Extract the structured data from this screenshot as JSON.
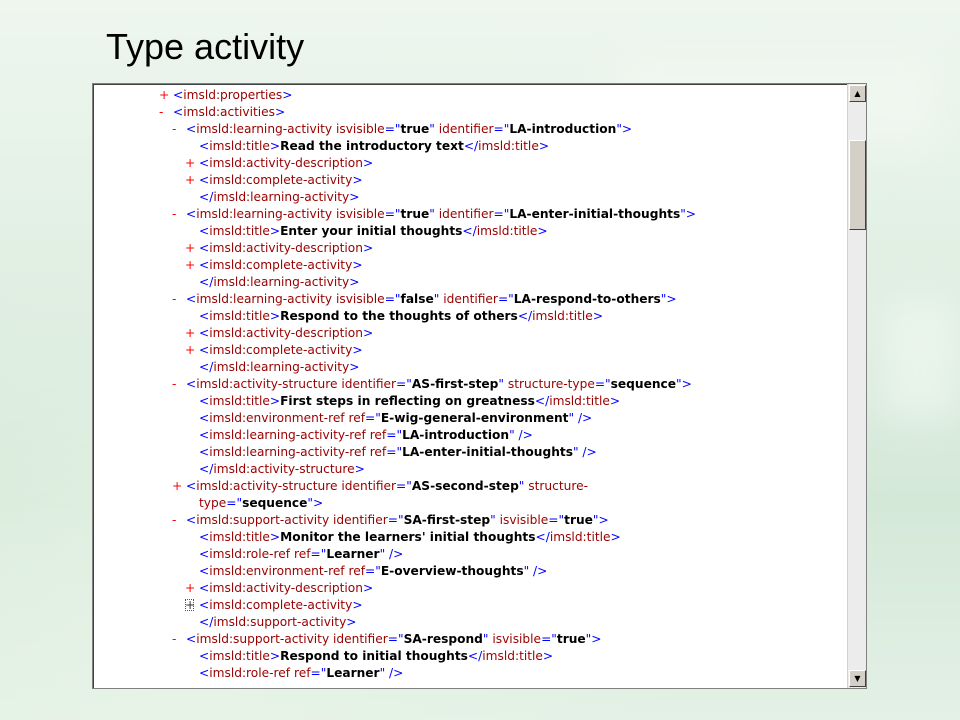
{
  "slide": {
    "title": "Type activity"
  },
  "xml_lines": [
    {
      "indent": 0,
      "toggle": "+",
      "segs": [
        [
          "tg",
          "<"
        ],
        [
          "t",
          "imsld:properties"
        ],
        [
          "tg",
          ">"
        ]
      ]
    },
    {
      "indent": 0,
      "toggle": "-",
      "segs": [
        [
          "tg",
          "<"
        ],
        [
          "t",
          "imsld:activities"
        ],
        [
          "tg",
          ">"
        ]
      ]
    },
    {
      "indent": 1,
      "toggle": "-",
      "segs": [
        [
          "tg",
          "<"
        ],
        [
          "t",
          "imsld:learning-activity "
        ],
        [
          "an",
          "isvisible"
        ],
        [
          "tg",
          "=\""
        ],
        [
          "tx",
          "true"
        ],
        [
          "tg",
          "\" "
        ],
        [
          "an",
          "identifier"
        ],
        [
          "tg",
          "=\""
        ],
        [
          "tx",
          "LA-introduction"
        ],
        [
          "tg",
          "\">"
        ]
      ]
    },
    {
      "indent": 2,
      "toggle": "",
      "segs": [
        [
          "tg",
          "<"
        ],
        [
          "t",
          "imsld:title"
        ],
        [
          "tg",
          ">"
        ],
        [
          "tx",
          "Read the introductory text"
        ],
        [
          "tg",
          "</"
        ],
        [
          "t",
          "imsld:title"
        ],
        [
          "tg",
          ">"
        ]
      ]
    },
    {
      "indent": 2,
      "toggle": "+",
      "segs": [
        [
          "tg",
          "<"
        ],
        [
          "t",
          "imsld:activity-description"
        ],
        [
          "tg",
          ">"
        ]
      ]
    },
    {
      "indent": 2,
      "toggle": "+",
      "segs": [
        [
          "tg",
          "<"
        ],
        [
          "t",
          "imsld:complete-activity"
        ],
        [
          "tg",
          ">"
        ]
      ]
    },
    {
      "indent": 2,
      "toggle": "",
      "segs": [
        [
          "tg",
          "</"
        ],
        [
          "t",
          "imsld:learning-activity"
        ],
        [
          "tg",
          ">"
        ]
      ]
    },
    {
      "indent": 1,
      "toggle": "-",
      "segs": [
        [
          "tg",
          "<"
        ],
        [
          "t",
          "imsld:learning-activity "
        ],
        [
          "an",
          "isvisible"
        ],
        [
          "tg",
          "=\""
        ],
        [
          "tx",
          "true"
        ],
        [
          "tg",
          "\" "
        ],
        [
          "an",
          "identifier"
        ],
        [
          "tg",
          "=\""
        ],
        [
          "tx",
          "LA-enter-initial-thoughts"
        ],
        [
          "tg",
          "\">"
        ]
      ]
    },
    {
      "indent": 2,
      "toggle": "",
      "segs": [
        [
          "tg",
          "<"
        ],
        [
          "t",
          "imsld:title"
        ],
        [
          "tg",
          ">"
        ],
        [
          "tx",
          "Enter your initial thoughts"
        ],
        [
          "tg",
          "</"
        ],
        [
          "t",
          "imsld:title"
        ],
        [
          "tg",
          ">"
        ]
      ]
    },
    {
      "indent": 2,
      "toggle": "+",
      "segs": [
        [
          "tg",
          "<"
        ],
        [
          "t",
          "imsld:activity-description"
        ],
        [
          "tg",
          ">"
        ]
      ]
    },
    {
      "indent": 2,
      "toggle": "+",
      "segs": [
        [
          "tg",
          "<"
        ],
        [
          "t",
          "imsld:complete-activity"
        ],
        [
          "tg",
          ">"
        ]
      ]
    },
    {
      "indent": 2,
      "toggle": "",
      "segs": [
        [
          "tg",
          "</"
        ],
        [
          "t",
          "imsld:learning-activity"
        ],
        [
          "tg",
          ">"
        ]
      ]
    },
    {
      "indent": 1,
      "toggle": "-",
      "segs": [
        [
          "tg",
          "<"
        ],
        [
          "t",
          "imsld:learning-activity "
        ],
        [
          "an",
          "isvisible"
        ],
        [
          "tg",
          "=\""
        ],
        [
          "tx",
          "false"
        ],
        [
          "tg",
          "\" "
        ],
        [
          "an",
          "identifier"
        ],
        [
          "tg",
          "=\""
        ],
        [
          "tx",
          "LA-respond-to-others"
        ],
        [
          "tg",
          "\">"
        ]
      ]
    },
    {
      "indent": 2,
      "toggle": "",
      "segs": [
        [
          "tg",
          "<"
        ],
        [
          "t",
          "imsld:title"
        ],
        [
          "tg",
          ">"
        ],
        [
          "tx",
          "Respond to the thoughts of others"
        ],
        [
          "tg",
          "</"
        ],
        [
          "t",
          "imsld:title"
        ],
        [
          "tg",
          ">"
        ]
      ]
    },
    {
      "indent": 2,
      "toggle": "+",
      "segs": [
        [
          "tg",
          "<"
        ],
        [
          "t",
          "imsld:activity-description"
        ],
        [
          "tg",
          ">"
        ]
      ]
    },
    {
      "indent": 2,
      "toggle": "+",
      "segs": [
        [
          "tg",
          "<"
        ],
        [
          "t",
          "imsld:complete-activity"
        ],
        [
          "tg",
          ">"
        ]
      ]
    },
    {
      "indent": 2,
      "toggle": "",
      "segs": [
        [
          "tg",
          "</"
        ],
        [
          "t",
          "imsld:learning-activity"
        ],
        [
          "tg",
          ">"
        ]
      ]
    },
    {
      "indent": 1,
      "toggle": "-",
      "segs": [
        [
          "tg",
          "<"
        ],
        [
          "t",
          "imsld:activity-structure "
        ],
        [
          "an",
          "identifier"
        ],
        [
          "tg",
          "=\""
        ],
        [
          "tx",
          "AS-first-step"
        ],
        [
          "tg",
          "\" "
        ],
        [
          "an",
          "structure-type"
        ],
        [
          "tg",
          "=\""
        ],
        [
          "tx",
          "sequence"
        ],
        [
          "tg",
          "\">"
        ]
      ]
    },
    {
      "indent": 2,
      "toggle": "",
      "segs": [
        [
          "tg",
          "<"
        ],
        [
          "t",
          "imsld:title"
        ],
        [
          "tg",
          ">"
        ],
        [
          "tx",
          "First steps in reflecting on greatness"
        ],
        [
          "tg",
          "</"
        ],
        [
          "t",
          "imsld:title"
        ],
        [
          "tg",
          ">"
        ]
      ]
    },
    {
      "indent": 2,
      "toggle": "",
      "segs": [
        [
          "tg",
          "<"
        ],
        [
          "t",
          "imsld:environment-ref "
        ],
        [
          "an",
          "ref"
        ],
        [
          "tg",
          "=\""
        ],
        [
          "tx",
          "E-wig-general-environment"
        ],
        [
          "tg",
          "\" />"
        ]
      ]
    },
    {
      "indent": 2,
      "toggle": "",
      "segs": [
        [
          "tg",
          "<"
        ],
        [
          "t",
          "imsld:learning-activity-ref "
        ],
        [
          "an",
          "ref"
        ],
        [
          "tg",
          "=\""
        ],
        [
          "tx",
          "LA-introduction"
        ],
        [
          "tg",
          "\" />"
        ]
      ]
    },
    {
      "indent": 2,
      "toggle": "",
      "segs": [
        [
          "tg",
          "<"
        ],
        [
          "t",
          "imsld:learning-activity-ref "
        ],
        [
          "an",
          "ref"
        ],
        [
          "tg",
          "=\""
        ],
        [
          "tx",
          "LA-enter-initial-thoughts"
        ],
        [
          "tg",
          "\" />"
        ]
      ]
    },
    {
      "indent": 2,
      "toggle": "",
      "segs": [
        [
          "tg",
          "</"
        ],
        [
          "t",
          "imsld:activity-structure"
        ],
        [
          "tg",
          ">"
        ]
      ]
    },
    {
      "indent": 1,
      "toggle": "+",
      "segs": [
        [
          "tg",
          "<"
        ],
        [
          "t",
          "imsld:activity-structure "
        ],
        [
          "an",
          "identifier"
        ],
        [
          "tg",
          "=\""
        ],
        [
          "tx",
          "AS-second-step"
        ],
        [
          "tg",
          "\" "
        ],
        [
          "an",
          "structure-"
        ]
      ]
    },
    {
      "indent": 2,
      "toggle": "",
      "segs": [
        [
          "an",
          "type"
        ],
        [
          "tg",
          "=\""
        ],
        [
          "tx",
          "sequence"
        ],
        [
          "tg",
          "\">"
        ]
      ]
    },
    {
      "indent": 1,
      "toggle": "-",
      "segs": [
        [
          "tg",
          "<"
        ],
        [
          "t",
          "imsld:support-activity "
        ],
        [
          "an",
          "identifier"
        ],
        [
          "tg",
          "=\""
        ],
        [
          "tx",
          "SA-first-step"
        ],
        [
          "tg",
          "\" "
        ],
        [
          "an",
          "isvisible"
        ],
        [
          "tg",
          "=\""
        ],
        [
          "tx",
          "true"
        ],
        [
          "tg",
          "\">"
        ]
      ]
    },
    {
      "indent": 2,
      "toggle": "",
      "segs": [
        [
          "tg",
          "<"
        ],
        [
          "t",
          "imsld:title"
        ],
        [
          "tg",
          ">"
        ],
        [
          "tx",
          "Monitor the learners' initial thoughts"
        ],
        [
          "tg",
          "</"
        ],
        [
          "t",
          "imsld:title"
        ],
        [
          "tg",
          ">"
        ]
      ]
    },
    {
      "indent": 2,
      "toggle": "",
      "segs": [
        [
          "tg",
          "<"
        ],
        [
          "t",
          "imsld:role-ref "
        ],
        [
          "an",
          "ref"
        ],
        [
          "tg",
          "=\""
        ],
        [
          "tx",
          "Learner"
        ],
        [
          "tg",
          "\" />"
        ]
      ]
    },
    {
      "indent": 2,
      "toggle": "",
      "segs": [
        [
          "tg",
          "<"
        ],
        [
          "t",
          "imsld:environment-ref "
        ],
        [
          "an",
          "ref"
        ],
        [
          "tg",
          "=\""
        ],
        [
          "tx",
          "E-overview-thoughts"
        ],
        [
          "tg",
          "\" />"
        ]
      ]
    },
    {
      "indent": 2,
      "toggle": "+",
      "segs": [
        [
          "tg",
          "<"
        ],
        [
          "t",
          "imsld:activity-description"
        ],
        [
          "tg",
          ">"
        ]
      ]
    },
    {
      "indent": 2,
      "toggle": "+box",
      "segs": [
        [
          "tg",
          "<"
        ],
        [
          "t",
          "imsld:complete-activity"
        ],
        [
          "tg",
          ">"
        ]
      ]
    },
    {
      "indent": 2,
      "toggle": "",
      "segs": [
        [
          "tg",
          "</"
        ],
        [
          "t",
          "imsld:support-activity"
        ],
        [
          "tg",
          ">"
        ]
      ]
    },
    {
      "indent": 1,
      "toggle": "-",
      "segs": [
        [
          "tg",
          "<"
        ],
        [
          "t",
          "imsld:support-activity "
        ],
        [
          "an",
          "identifier"
        ],
        [
          "tg",
          "=\""
        ],
        [
          "tx",
          "SA-respond"
        ],
        [
          "tg",
          "\" "
        ],
        [
          "an",
          "isvisible"
        ],
        [
          "tg",
          "=\""
        ],
        [
          "tx",
          "true"
        ],
        [
          "tg",
          "\">"
        ]
      ]
    },
    {
      "indent": 2,
      "toggle": "",
      "segs": [
        [
          "tg",
          "<"
        ],
        [
          "t",
          "imsld:title"
        ],
        [
          "tg",
          ">"
        ],
        [
          "tx",
          "Respond to initial thoughts"
        ],
        [
          "tg",
          "</"
        ],
        [
          "t",
          "imsld:title"
        ],
        [
          "tg",
          ">"
        ]
      ]
    },
    {
      "indent": 2,
      "toggle": "",
      "segs": [
        [
          "tg",
          "<"
        ],
        [
          "t",
          "imsld:role-ref "
        ],
        [
          "an",
          "ref"
        ],
        [
          "tg",
          "=\""
        ],
        [
          "tx",
          "Learner"
        ],
        [
          "tg",
          "\" />"
        ]
      ]
    }
  ],
  "scrollbar": {
    "up_icon": "arrow-up-icon",
    "down_icon": "arrow-down-icon",
    "position": 0.08
  }
}
